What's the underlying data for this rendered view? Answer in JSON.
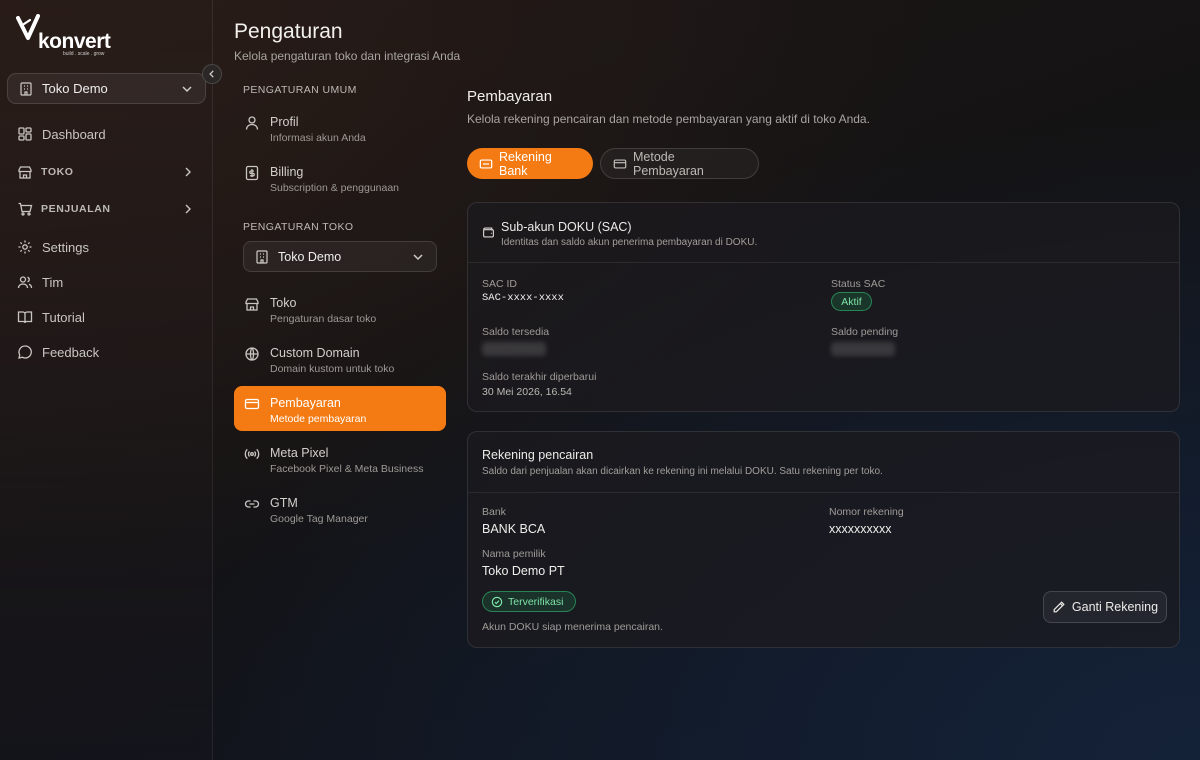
{
  "brand": {
    "name": "konvert",
    "tagline": "build . scale . grow",
    "accent": "#f47b13"
  },
  "sidebar": {
    "store_selector": {
      "label": "Toko Demo"
    },
    "items": [
      {
        "label": "Dashboard",
        "icon": "dashboard-icon"
      },
      {
        "label": "TOKO",
        "icon": "store-icon",
        "expandable": true
      },
      {
        "label": "PENJUALAN",
        "icon": "cart-icon",
        "expandable": true
      },
      {
        "label": "Settings",
        "icon": "gear-icon"
      },
      {
        "label": "Tim",
        "icon": "users-icon"
      },
      {
        "label": "Tutorial",
        "icon": "book-icon"
      },
      {
        "label": "Feedback",
        "icon": "message-icon"
      }
    ]
  },
  "header": {
    "title": "Pengaturan",
    "subtitle": "Kelola pengaturan toko dan integrasi Anda"
  },
  "settings_nav": {
    "general_heading": "PENGATURAN UMUM",
    "general_items": [
      {
        "title": "Profil",
        "desc": "Informasi akun Anda",
        "icon": "user-icon"
      },
      {
        "title": "Billing",
        "desc": "Subscription & penggunaan",
        "icon": "billing-icon"
      }
    ],
    "store_heading": "PENGATURAN TOKO",
    "store_selector": "Toko Demo",
    "store_items": [
      {
        "title": "Toko",
        "desc": "Pengaturan dasar toko",
        "icon": "store-icon"
      },
      {
        "title": "Custom Domain",
        "desc": "Domain kustom untuk toko",
        "icon": "globe-icon"
      },
      {
        "title": "Pembayaran",
        "desc": "Metode pembayaran",
        "icon": "credit-card-icon",
        "active": true
      },
      {
        "title": "Meta Pixel",
        "desc": "Facebook Pixel & Meta Business",
        "icon": "broadcast-icon"
      },
      {
        "title": "GTM",
        "desc": "Google Tag Manager",
        "icon": "link-icon"
      }
    ]
  },
  "payment": {
    "title": "Pembayaran",
    "subtitle": "Kelola rekening pencairan dan metode pembayaran yang aktif di toko Anda.",
    "tabs": [
      {
        "label": "Rekening Bank",
        "active": true
      },
      {
        "label": "Metode Pembayaran",
        "active": false
      }
    ],
    "sac_card": {
      "title": "Sub-akun DOKU (SAC)",
      "subtitle": "Identitas dan saldo akun penerima pembayaran di DOKU.",
      "sac_id_label": "SAC ID",
      "sac_id_value": "SAC-xxxx-xxxx",
      "status_label": "Status SAC",
      "status_value": "Aktif",
      "saldo_tersedia_label": "Saldo tersedia",
      "saldo_pending_label": "Saldo pending",
      "updated_label": "Saldo terakhir diperbarui",
      "updated_value": "30 Mei 2026, 16.54"
    },
    "rekening_card": {
      "title": "Rekening pencairan",
      "subtitle": "Saldo dari penjualan akan dicairkan ke rekening ini melalui DOKU. Satu rekening per toko.",
      "bank_label": "Bank",
      "bank_value": "BANK BCA",
      "nomor_label": "Nomor rekening",
      "nomor_value": "xxxxxxxxxx",
      "pemilik_label": "Nama pemilik",
      "pemilik_value": "Toko Demo PT",
      "verified_label": "Terverifikasi",
      "note": "Akun DOKU siap menerima pencairan.",
      "change_button": "Ganti Rekening"
    }
  }
}
